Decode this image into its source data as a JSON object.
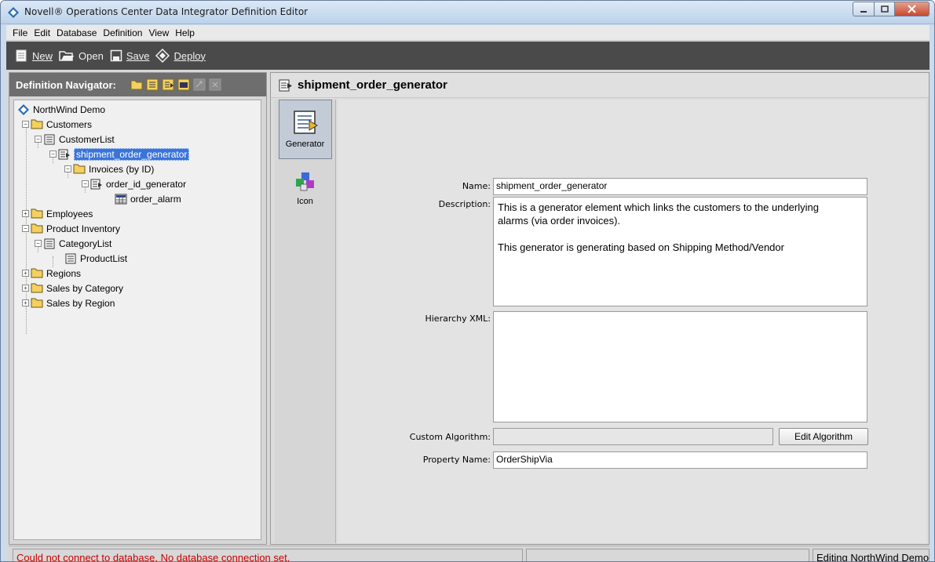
{
  "window": {
    "title": "Novell® Operations Center Data Integrator Definition Editor"
  },
  "menu": [
    "File",
    "Edit",
    "Database",
    "Definition",
    "View",
    "Help"
  ],
  "toolbar": {
    "new_label": "New",
    "open_label": "Open",
    "save_label": "Save",
    "deploy_label": "Deploy"
  },
  "navigator": {
    "title": "Definition Navigator:",
    "tools": [
      "new-folder-icon",
      "new-list-icon",
      "new-generator-icon",
      "new-alarm-icon",
      "move-icon",
      "delete-icon"
    ],
    "tree": {
      "root": "NorthWind Demo",
      "customers": "Customers",
      "customer_list": "CustomerList",
      "shipment_gen": "shipment_order_generator",
      "invoices": "Invoices (by ID)",
      "order_id_gen": "order_id_generator",
      "order_alarm": "order_alarm",
      "employees": "Employees",
      "product_inventory": "Product Inventory",
      "category_list": "CategoryList",
      "product_list": "ProductList",
      "regions": "Regions",
      "sales_by_category": "Sales by Category",
      "sales_by_region": "Sales by Region"
    }
  },
  "main": {
    "title": "shipment_order_generator",
    "tabs": [
      {
        "label": "Generator",
        "icon": "generator-icon",
        "active": true
      },
      {
        "label": "Icon",
        "icon": "icon-picker-icon",
        "active": false
      }
    ],
    "form": {
      "name_label": "Name:",
      "name_value": "shipment_order_generator",
      "description_label": "Description:",
      "description_value": "This is a generator element which links the customers to the underlying\nalarms (via order invoices).\n\nThis generator is generating based on Shipping Method/Vendor",
      "hierarchy_label": "Hierarchy XML:",
      "hierarchy_value": "",
      "custom_algorithm_label": "Custom Algorithm:",
      "custom_algorithm_value": "",
      "edit_algorithm_label": "Edit Algorithm",
      "property_name_label": "Property Name:",
      "property_name_value": "OrderShipVia"
    }
  },
  "status": {
    "message": "Could not connect to database. No database connection set.",
    "middle": "",
    "right": "Editing NorthWind Demo"
  },
  "colors": {
    "toolbar_bg": "#4a4a4a",
    "nav_header_bg": "#6e6e6e",
    "selection": "#3a74d8",
    "error_text": "#cc0000"
  }
}
